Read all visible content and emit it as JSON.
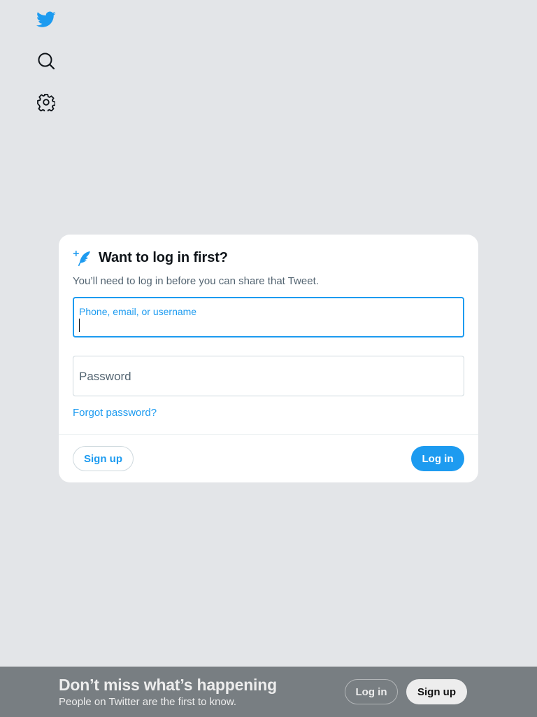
{
  "sidebar": {
    "items": [
      {
        "icon": "twitter-bird-icon",
        "color": "#1d9bf0"
      },
      {
        "icon": "search-icon",
        "color": "#0f1419"
      },
      {
        "icon": "gear-icon",
        "color": "#0f1419"
      }
    ]
  },
  "modal": {
    "icon": "feather-plus-icon",
    "title": "Want to log in first?",
    "subtitle": "You’ll need to log in before you can share that Tweet.",
    "phone_field": {
      "label": "Phone, email, or username",
      "value": ""
    },
    "password_field": {
      "label": "Password",
      "value": ""
    },
    "forgot_label": "Forgot password?",
    "signup_label": "Sign up",
    "login_label": "Log in"
  },
  "bottom_bar": {
    "headline": "Don’t miss what’s happening",
    "subtext": "People on Twitter are the first to know.",
    "login_label": "Log in",
    "signup_label": "Sign up"
  },
  "colors": {
    "accent": "#1d9bf0",
    "backdrop": "#e3e5e8",
    "text_primary": "#0f1419",
    "text_secondary": "#536471"
  }
}
